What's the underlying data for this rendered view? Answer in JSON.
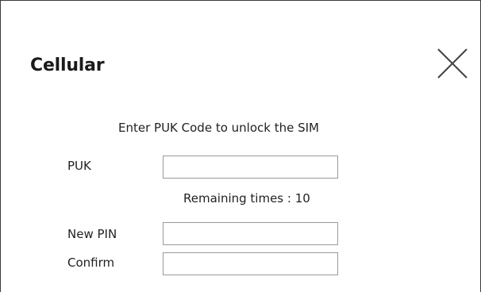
{
  "dialog": {
    "title": "Cellular",
    "close_icon": "close-icon",
    "instruction": "Enter PUK Code to unlock the SIM",
    "fields": {
      "puk": {
        "label": "PUK",
        "value": ""
      },
      "new_pin": {
        "label": "New PIN",
        "value": ""
      },
      "confirm": {
        "label": "Confirm",
        "value": ""
      }
    },
    "remaining": "Remaining times : 10"
  }
}
